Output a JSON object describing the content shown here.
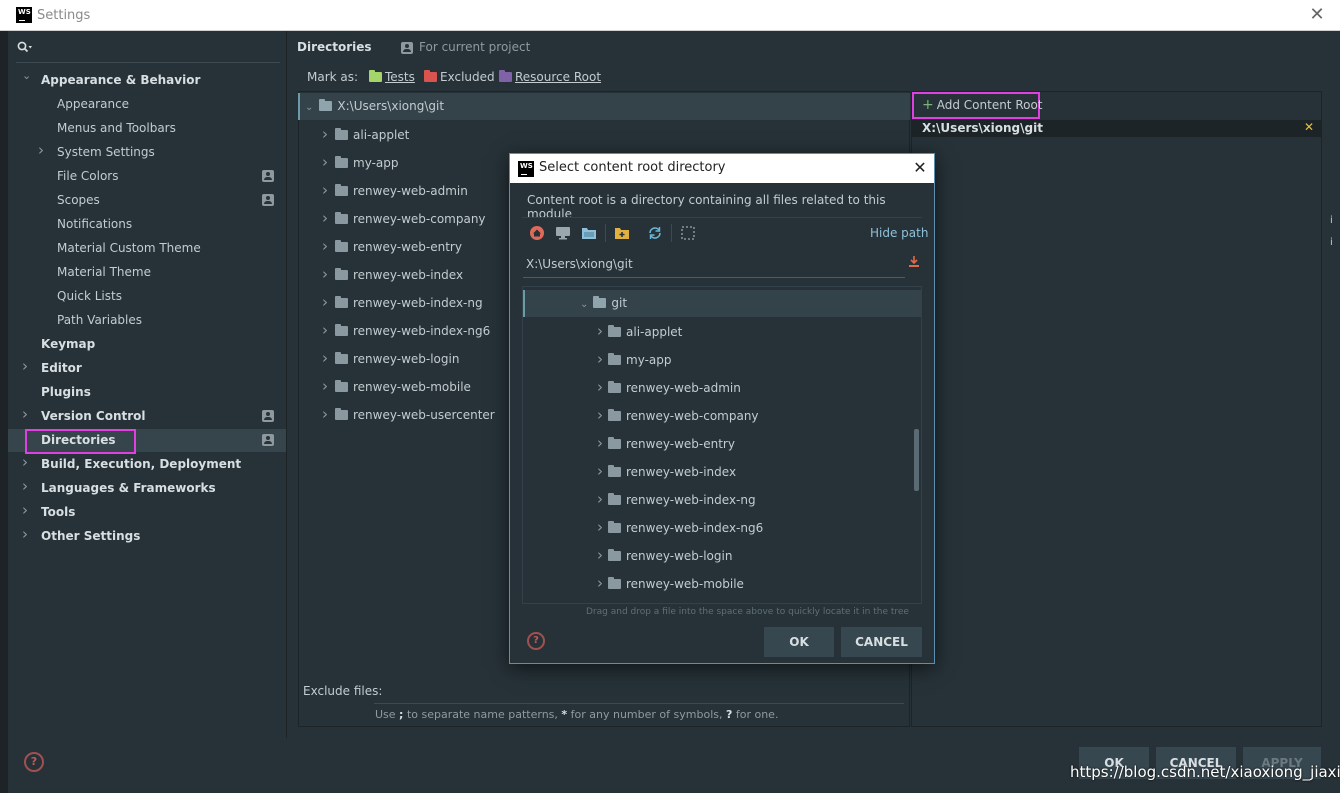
{
  "window": {
    "title": "Settings",
    "logo_text": "WS",
    "close_glyph": "✕"
  },
  "sidebar": {
    "search_icon": "search-icon",
    "items": [
      {
        "label": "Appearance & Behavior",
        "level": 0,
        "expanded": true
      },
      {
        "label": "Appearance",
        "level": 1
      },
      {
        "label": "Menus and Toolbars",
        "level": 1
      },
      {
        "label": "System Settings",
        "level": 1,
        "expandable": true
      },
      {
        "label": "File Colors",
        "level": 1,
        "project": true
      },
      {
        "label": "Scopes",
        "level": 1,
        "project": true
      },
      {
        "label": "Notifications",
        "level": 1
      },
      {
        "label": "Material Custom Theme",
        "level": 1
      },
      {
        "label": "Material Theme",
        "level": 1
      },
      {
        "label": "Quick Lists",
        "level": 1
      },
      {
        "label": "Path Variables",
        "level": 1
      },
      {
        "label": "Keymap",
        "level": 0
      },
      {
        "label": "Editor",
        "level": 0,
        "expandable": true
      },
      {
        "label": "Plugins",
        "level": 0
      },
      {
        "label": "Version Control",
        "level": 0,
        "expandable": true,
        "project": true
      },
      {
        "label": "Directories",
        "level": 0,
        "selected": true,
        "project": true
      },
      {
        "label": "Build, Execution, Deployment",
        "level": 0,
        "expandable": true
      },
      {
        "label": "Languages & Frameworks",
        "level": 0,
        "expandable": true
      },
      {
        "label": "Tools",
        "level": 0,
        "expandable": true
      },
      {
        "label": "Other Settings",
        "level": 0,
        "expandable": true
      }
    ]
  },
  "main": {
    "title": "Directories",
    "for_project": "For current project",
    "mark_as_label": "Mark as:",
    "mark_buttons": [
      {
        "label": "Tests",
        "color": "#a5d46a"
      },
      {
        "label": "Excluded",
        "color": "#d9534f"
      },
      {
        "label": "Resource Root",
        "color": "#8062a8"
      }
    ],
    "root": "X:\\Users\\xiong\\git",
    "folders": [
      "ali-applet",
      "my-app",
      "renwey-web-admin",
      "renwey-web-company",
      "renwey-web-entry",
      "renwey-web-index",
      "renwey-web-index-ng",
      "renwey-web-index-ng6",
      "renwey-web-login",
      "renwey-web-mobile",
      "renwey-web-usercenter"
    ],
    "exclude_label": "Exclude files:",
    "exclude_hint": {
      "a": "Use ",
      "b": ";",
      "c": " to separate name patterns, ",
      "d": "*",
      "e": " for any number of symbols, ",
      "f": "?",
      "g": " for one."
    }
  },
  "right_panel": {
    "add_content_root": "Add Content Root",
    "content_root": "X:\\Users\\xiong\\git",
    "remove_glyph": "✕"
  },
  "bottom": {
    "help": "?",
    "ok": "OK",
    "cancel": "CANCEL",
    "apply": "APPLY",
    "watermark": "https://blog.csdn.net/xiaoxiong_jiaxin"
  },
  "modal": {
    "title": "Select content root directory",
    "logo_text": "WS",
    "close_glyph": "✕",
    "description": "Content root is a directory containing all files related to this module",
    "toolbar_icons": [
      "home-icon",
      "desktop-icon",
      "project-folder-icon",
      "new-folder-icon",
      "refresh-icon",
      "select-all-icon"
    ],
    "hide_path": "Hide path",
    "path": "X:\\Users\\xiong\\git",
    "tree_root": "git",
    "tree_items": [
      "ali-applet",
      "my-app",
      "renwey-web-admin",
      "renwey-web-company",
      "renwey-web-entry",
      "renwey-web-index",
      "renwey-web-index-ng",
      "renwey-web-index-ng6",
      "renwey-web-login",
      "renwey-web-mobile"
    ],
    "drop_hint": "Drag and drop a file into the space above to quickly locate it in the tree",
    "help": "?",
    "ok": "OK",
    "cancel": "CANCEL"
  },
  "colors": {
    "accent_highlight": "#e040e0",
    "background": "#263238",
    "selection": "#36444b"
  }
}
